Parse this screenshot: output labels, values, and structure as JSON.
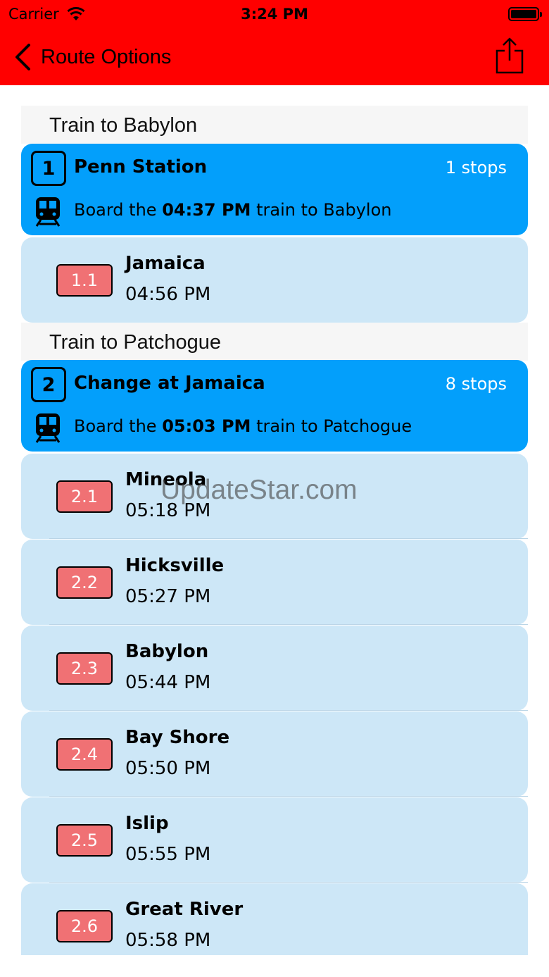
{
  "status_bar": {
    "carrier": "Carrier",
    "time": "3:24 PM"
  },
  "nav": {
    "back_label": "Route Options"
  },
  "colors": {
    "nav_bg": "#ff0000",
    "leg_bg": "#039ffb",
    "stop_bg": "#cde7f7",
    "badge_bg": "#f07174"
  },
  "sections": [
    {
      "title": "Train to Babylon",
      "leg": {
        "number": "1",
        "station": "Penn Station",
        "stops": "1 stops",
        "board_prefix": "Board the",
        "board_time": "04:37 PM",
        "board_suffix": "train to Babylon"
      },
      "stops": [
        {
          "code": "1.1",
          "name": "Jamaica",
          "time": "04:56 PM"
        }
      ]
    },
    {
      "title": "Train to Patchogue",
      "leg": {
        "number": "2",
        "station": "Change at Jamaica",
        "stops": "8 stops",
        "board_prefix": "Board the",
        "board_time": "05:03 PM",
        "board_suffix": "train to Patchogue"
      },
      "stops": [
        {
          "code": "2.1",
          "name": "Mineola",
          "time": "05:18 PM"
        },
        {
          "code": "2.2",
          "name": "Hicksville",
          "time": "05:27 PM"
        },
        {
          "code": "2.3",
          "name": "Babylon",
          "time": "05:44 PM"
        },
        {
          "code": "2.4",
          "name": "Bay Shore",
          "time": "05:50 PM"
        },
        {
          "code": "2.5",
          "name": "Islip",
          "time": "05:55 PM"
        },
        {
          "code": "2.6",
          "name": "Great River",
          "time": "05:58 PM"
        }
      ]
    }
  ],
  "watermark": "UpdateStar.com"
}
